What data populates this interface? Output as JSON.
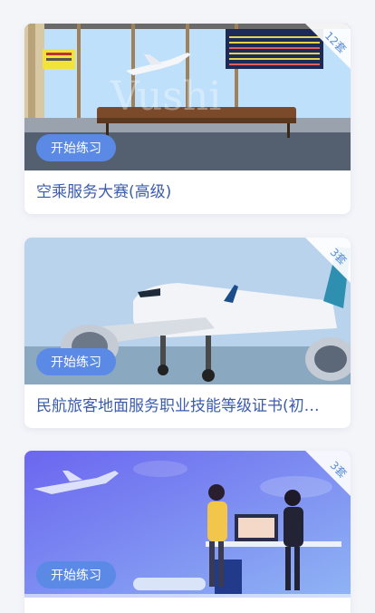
{
  "courses": [
    {
      "title": "空乘服务大赛(高级)",
      "count": "12套",
      "button": "开始练习",
      "watermark": "Vushi"
    },
    {
      "title": "民航旅客地面服务职业技能等级证书(初…",
      "count": "3套",
      "button": "开始练习"
    },
    {
      "title": "",
      "count": "3套",
      "button": "开始练习"
    }
  ],
  "colors": {
    "accent": "#5b8ae6",
    "title": "#3a5cab",
    "background": "#f4f5f9"
  }
}
